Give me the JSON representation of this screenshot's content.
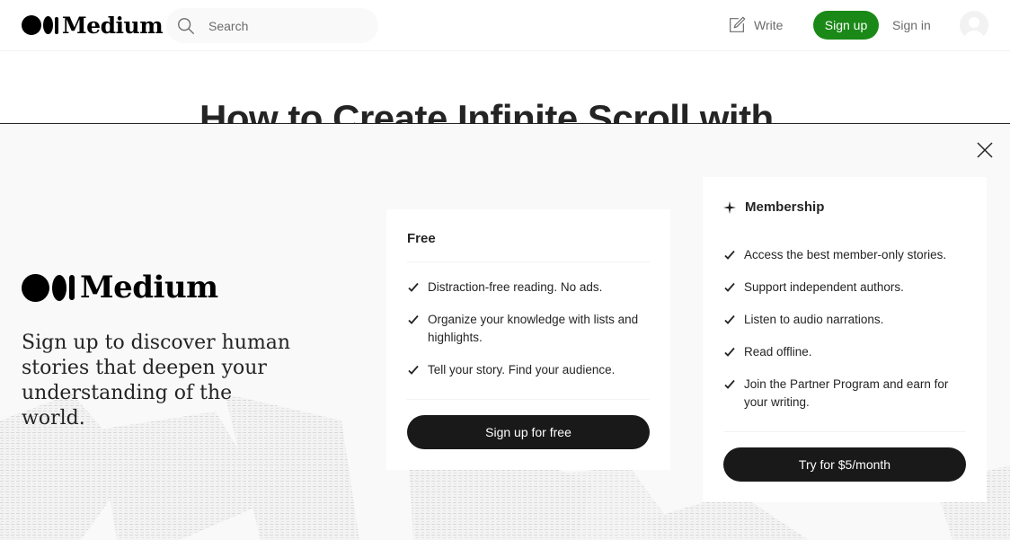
{
  "nav": {
    "logo_text": "Medium",
    "search_placeholder": "Search",
    "write_label": "Write",
    "signup_label": "Sign up",
    "signin_label": "Sign in"
  },
  "article": {
    "title": "How to Create Infinite Scroll with"
  },
  "modal": {
    "logo_text": "Medium",
    "tagline": "Sign up to discover human stories that deepen your understanding of the world.",
    "free": {
      "title": "Free",
      "features": [
        "Distraction-free reading. No ads.",
        "Organize your knowledge with lists and highlights.",
        "Tell your story. Find your audience."
      ],
      "button": "Sign up for free"
    },
    "membership": {
      "title": "Membership",
      "features": [
        "Access the best member-only stories.",
        "Support independent authors.",
        "Listen to audio narrations.",
        "Read offline.",
        "Join the Partner Program and earn for your writing."
      ],
      "button": "Try for $5/month"
    }
  },
  "colors": {
    "brand_green": "#1a8917",
    "dark_button": "#191919",
    "text": "#242424",
    "muted": "#6b6b6b"
  }
}
